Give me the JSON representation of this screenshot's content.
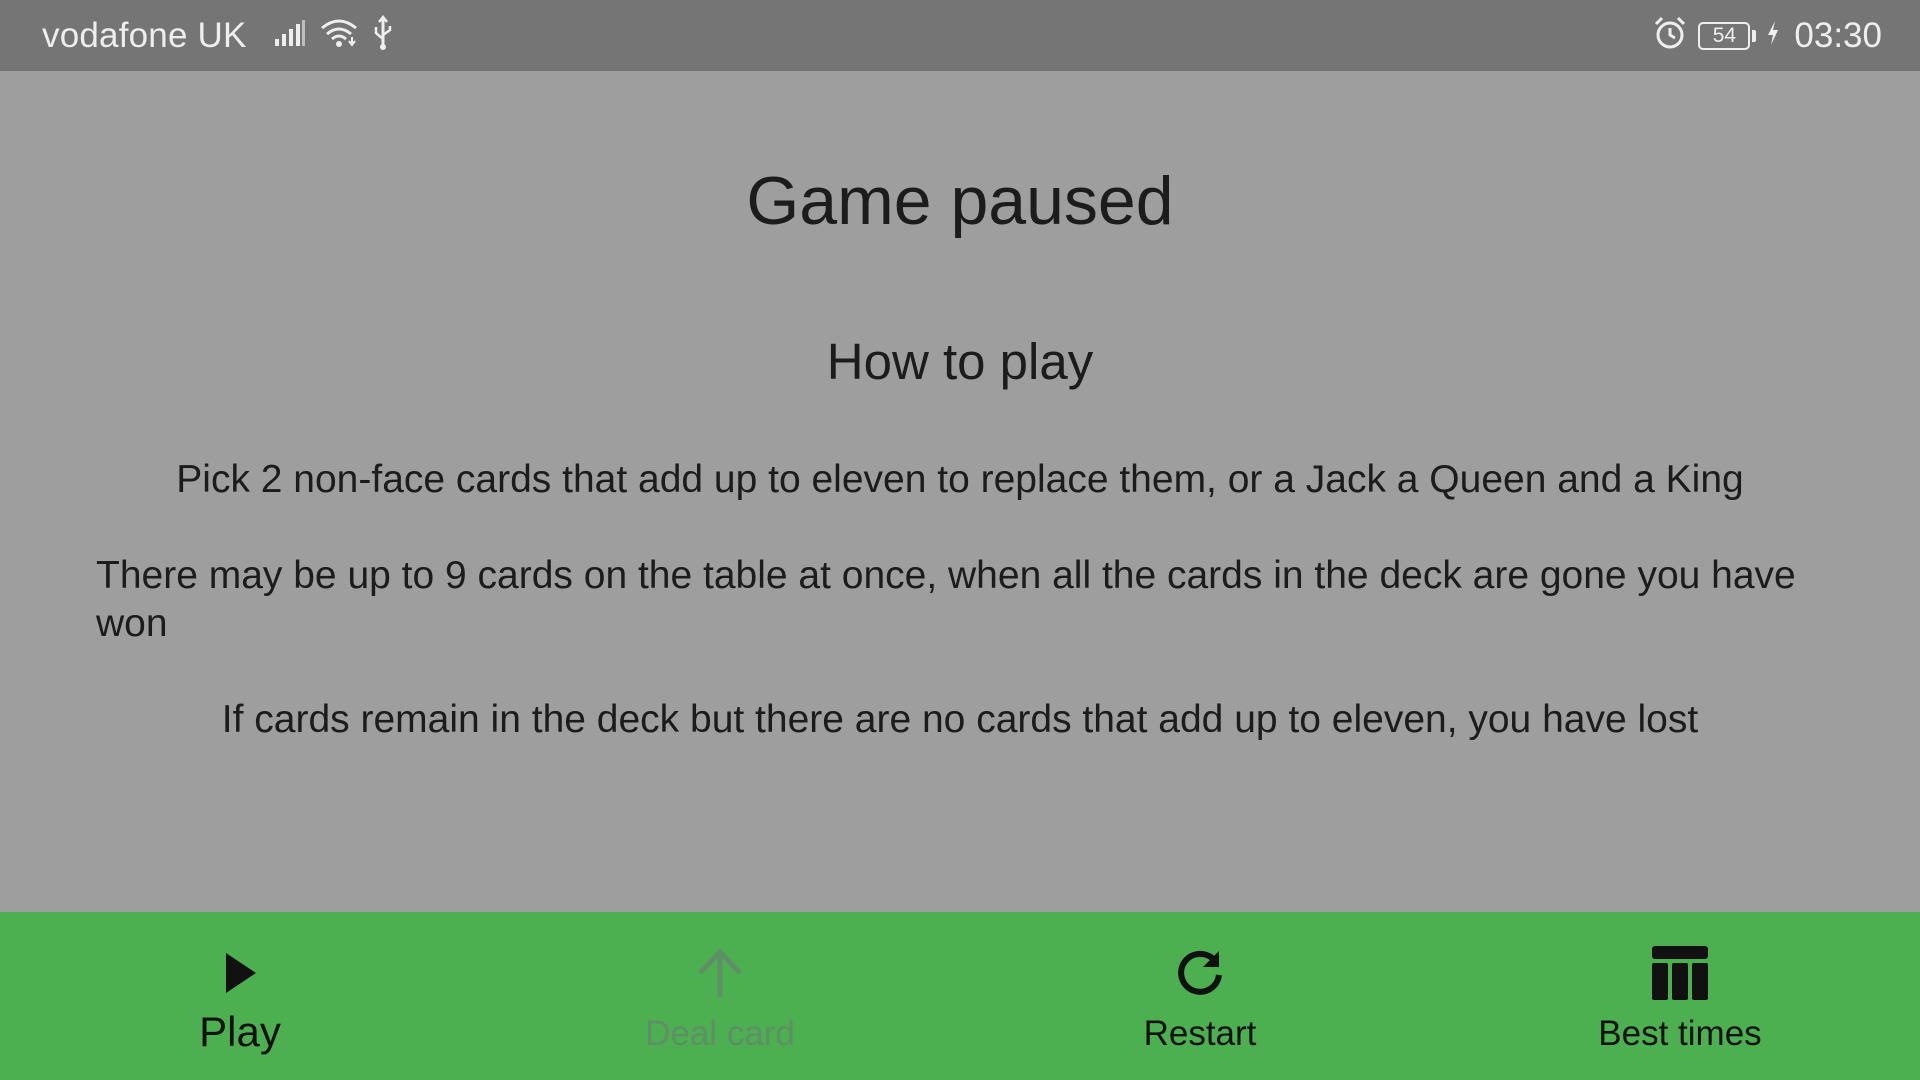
{
  "status_bar": {
    "carrier": "vodafone UK",
    "battery_level": "54",
    "time": "03:30",
    "icons": [
      "signal-icon",
      "wifi-icon",
      "usb-icon",
      "alarm-icon",
      "battery-icon",
      "charging-icon"
    ]
  },
  "main": {
    "title": "Game paused",
    "subtitle": "How to play",
    "rules": [
      "Pick 2 non-face cards that add up to eleven to replace them, or a Jack a Queen and a King",
      "There may be up to 9 cards on the table at once, when all the cards in the deck are gone you have won",
      "If cards remain in the deck but there are no cards that add up to eleven, you have lost"
    ]
  },
  "bottom_nav": {
    "items": [
      {
        "label": "Play",
        "icon": "play-icon",
        "state": "active"
      },
      {
        "label": "Deal card",
        "icon": "arrow-up-icon",
        "state": "disabled"
      },
      {
        "label": "Restart",
        "icon": "refresh-icon",
        "state": "normal"
      },
      {
        "label": "Best times",
        "icon": "table-icon",
        "state": "normal"
      }
    ]
  },
  "colors": {
    "status_bar_bg": "#757575",
    "content_bg": "#9e9e9e",
    "nav_bg": "#4caf50",
    "disabled_text": "#5f8f66"
  }
}
